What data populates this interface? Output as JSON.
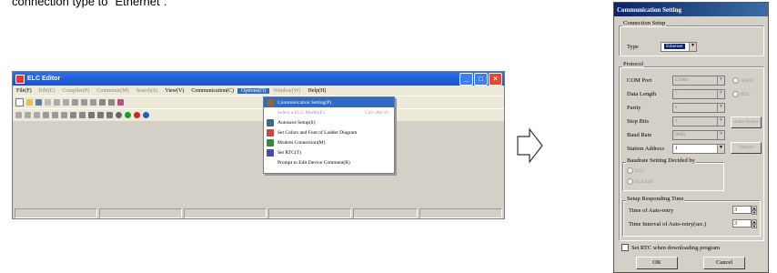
{
  "caption": "connection type to “Ethernet”.",
  "editor": {
    "title": "ELC Editor",
    "menus": [
      {
        "label": "File(F)",
        "disabled": false
      },
      {
        "label": "Edit(E)",
        "disabled": true
      },
      {
        "label": "Compiler(P)",
        "disabled": true
      },
      {
        "label": "Comments(M)",
        "disabled": true
      },
      {
        "label": "Search(S)",
        "disabled": true
      },
      {
        "label": "View(V)",
        "disabled": false
      },
      {
        "label": "Communication(C)",
        "disabled": false
      },
      {
        "label": "Options(O)",
        "disabled": false,
        "open": true
      },
      {
        "label": "Window(W)",
        "disabled": true
      },
      {
        "label": "Help(H)",
        "disabled": false
      }
    ],
    "options_menu": [
      {
        "label": "Communication Setting(P)",
        "selected": true,
        "icon": "connection-icon"
      },
      {
        "label": "Select a ELC Model(E)",
        "shortcut": "Ctrl+Alt+N",
        "disabled": true,
        "icon": ""
      },
      {
        "label": "Autosave Setup(S)",
        "icon": "autosave-icon"
      },
      {
        "label": "Set Colors and Font of Ladder Diagram",
        "icon": "colors-icon"
      },
      {
        "label": "Modem Connection(M)",
        "icon": "modem-icon"
      },
      {
        "label": "Set RTC(T)",
        "icon": "rtc-icon"
      },
      {
        "label": "Prompt to Edit Device Comment(R)",
        "icon": ""
      }
    ]
  },
  "dialog": {
    "title": "Communication Setting",
    "connection_group": "Connection Setup",
    "type_label": "Type",
    "type_value": "Ethernet",
    "protocol_group": "Protocol",
    "com_port_label": "COM Port",
    "com_port_value": "COM1",
    "data_length_label": "Data Length",
    "data_length_value": "7",
    "parity_label": "Parity",
    "parity_value": "e",
    "stop_bits_label": "Stop Bits",
    "stop_bits_value": "1",
    "baud_rate_label": "Baud Rate",
    "baud_rate_value": "9600",
    "station_address_label": "Station Address",
    "station_address_value": "1",
    "ascii_label": "ASCII",
    "rtu_label": "RTU",
    "auto_detect_label": "Auto-Detect",
    "default_label": "Default",
    "baudrate_group": "Baudrate Setting Decided by",
    "baud_opt_elc": "ELC",
    "baud_opt_elcsoft": "ELCSoft",
    "setup_time_group": "Setup Responding Time",
    "auto_retry_label": "Time of Auto-retry",
    "auto_retry_value": "3",
    "interval_label": "Time Interval of Auto-retry(sec.)",
    "interval_value": "3",
    "rtc_check_label": "Set RTC when downloading program",
    "ok_label": "OK",
    "cancel_label": "Cancel"
  }
}
